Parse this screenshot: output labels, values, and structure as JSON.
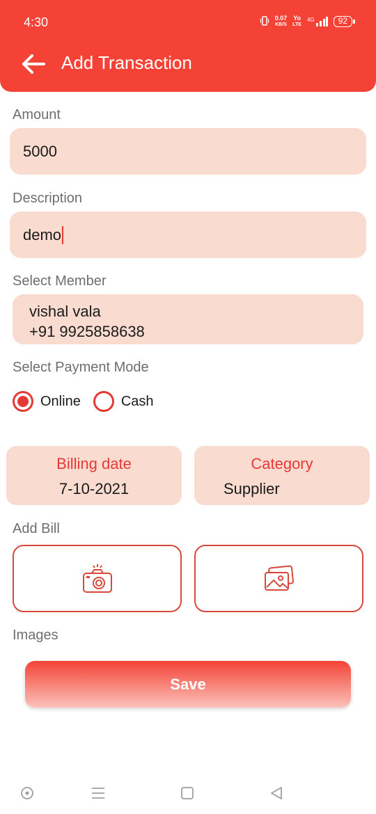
{
  "status_bar": {
    "time": "4:30",
    "net_speed_value": "0.07",
    "net_speed_unit": "KB/S",
    "volte": "Yo",
    "volte_sub": "LTE",
    "network": "4G",
    "battery": "92"
  },
  "header": {
    "title": "Add Transaction",
    "back_icon": "arrow-left-icon"
  },
  "form": {
    "amount": {
      "label": "Amount",
      "value": "5000"
    },
    "description": {
      "label": "Description",
      "value": "demo"
    },
    "member": {
      "label": "Select Member",
      "name": "vishal vala",
      "phone": "+91 9925858638"
    },
    "payment_mode": {
      "label": "Select Payment Mode",
      "options": [
        {
          "label": "Online",
          "selected": true
        },
        {
          "label": "Cash",
          "selected": false
        }
      ]
    },
    "billing_date": {
      "title": "Billing date",
      "value": "7-10-2021"
    },
    "category": {
      "title": "Category",
      "value": "Supplier"
    },
    "add_bill": {
      "label": "Add Bill",
      "camera_icon": "camera-icon",
      "gallery_icon": "gallery-icon"
    },
    "images_label": "Images",
    "save_label": "Save"
  },
  "colors": {
    "accent": "#f44336",
    "field_bg": "#fadbd0",
    "label": "#6e6e6e"
  },
  "nav": [
    "circle-icon",
    "menu-icon",
    "home-square-icon",
    "back-triangle-icon"
  ]
}
